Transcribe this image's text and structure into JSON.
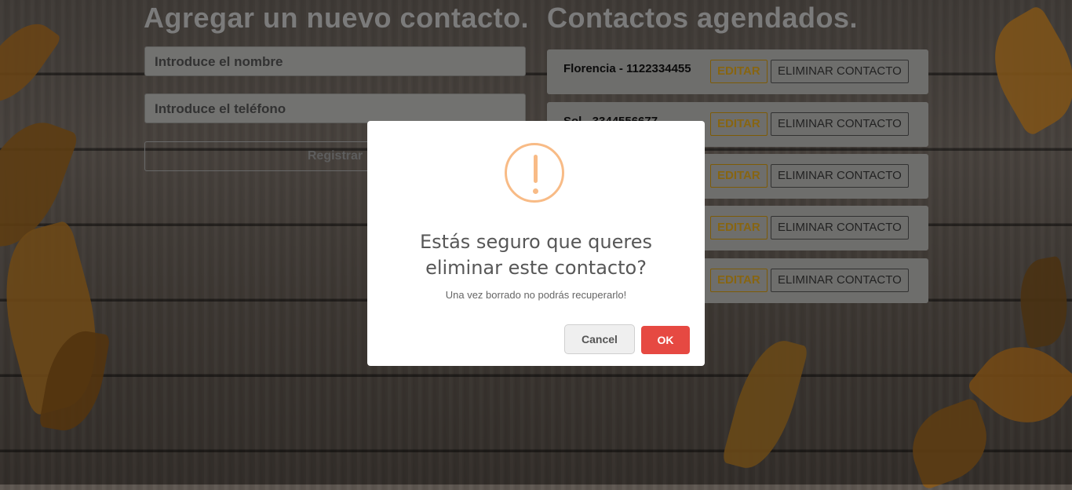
{
  "form": {
    "heading": "Agregar un nuevo contacto.",
    "name_placeholder": "Introduce el nombre",
    "phone_placeholder": "Introduce el teléfono",
    "register_label": "Registrar"
  },
  "contacts": {
    "heading": "Contactos agendados.",
    "edit_label": "EDITAR",
    "delete_label": "ELIMINAR CONTACTO",
    "items": [
      {
        "text": "Florencia - 1122334455"
      },
      {
        "text": "Sol - 3344556677"
      },
      {
        "text": ""
      },
      {
        "text": ""
      },
      {
        "text": ""
      }
    ]
  },
  "modal": {
    "icon": "warning-icon",
    "title": "Estás seguro que queres eliminar este contacto?",
    "text": "Una vez borrado no podrás recuperarlo!",
    "cancel_label": "Cancel",
    "ok_label": "OK"
  },
  "colors": {
    "warning": "#f8bb86",
    "ok_button": "#e64942",
    "edit_accent": "#c8951a"
  }
}
